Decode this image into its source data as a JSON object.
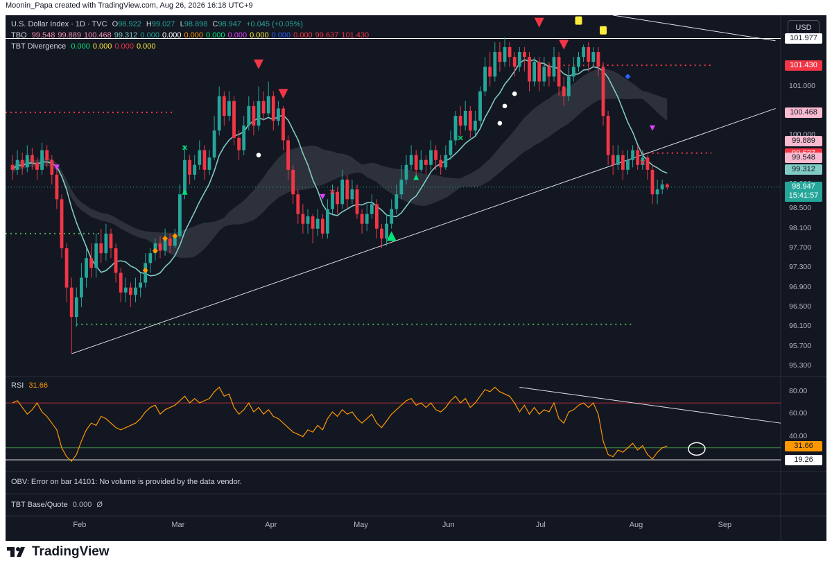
{
  "header": {
    "text": "Moonin_Papa created with TradingView.com, Aug 26, 2026 16:18 UTC+9"
  },
  "legend": {
    "symbol": "U.S. Dollar Index · 1D · TVC",
    "o_label": "O",
    "o_value": "98.922",
    "h_label": "H",
    "h_value": "99.027",
    "l_label": "L",
    "l_value": "98.898",
    "c_label": "C",
    "c_value": "98.947",
    "change": "+0.045 (+0.05%)",
    "tbo_label": "TBO",
    "tbo_values": [
      {
        "v": "99.548",
        "color": "#f48fb1"
      },
      {
        "v": "99.889",
        "color": "#f48fb1"
      },
      {
        "v": "100.468",
        "color": "#f48fb1"
      },
      {
        "v": "99.312",
        "color": "#80cbc4"
      },
      {
        "v": "0.000",
        "color": "#26a69a"
      },
      {
        "v": "0.000",
        "color": "#ffffff"
      },
      {
        "v": "0.000",
        "color": "#ff9800"
      },
      {
        "v": "0.000",
        "color": "#00e676"
      },
      {
        "v": "0.000",
        "color": "#e040fb"
      },
      {
        "v": "0.000",
        "color": "#ffeb3b"
      },
      {
        "v": "0.000",
        "color": "#2962ff"
      },
      {
        "v": "0.000",
        "color": "#f23645"
      },
      {
        "v": "99.637",
        "color": "#f23645"
      },
      {
        "v": "101.430",
        "color": "#f23645"
      }
    ],
    "div_label": "TBT Divergence",
    "div_values": [
      {
        "v": "0.000",
        "color": "#00e676"
      },
      {
        "v": "0.000",
        "color": "#ffeb3b"
      },
      {
        "v": "0.000",
        "color": "#f23645"
      },
      {
        "v": "0.000",
        "color": "#ffeb3b"
      }
    ]
  },
  "currency_button": "USD",
  "price_axis": [
    "101.000",
    "100.500",
    "100.000",
    "99.500",
    "99.000",
    "98.500",
    "98.100",
    "97.700",
    "97.300",
    "96.900",
    "96.500",
    "96.100",
    "95.700",
    "95.300"
  ],
  "price_labels": [
    {
      "text": "101.977",
      "bg": "#ffffff",
      "fg": "#131722",
      "price": 101.977
    },
    {
      "text": "101.430",
      "bg": "#f23645",
      "fg": "#ffffff",
      "price": 101.43
    },
    {
      "text": "100.468",
      "bg": "#f8bbd0",
      "fg": "#131722",
      "price": 100.468
    },
    {
      "text": "99.889",
      "bg": "#f8bbd0",
      "fg": "#131722",
      "price": 99.889
    },
    {
      "text": "99.637",
      "bg": "#f23645",
      "fg": "#ffffff",
      "price": 99.637
    },
    {
      "text": "99.548",
      "bg": "#f8bbd0",
      "fg": "#131722",
      "price": 99.548
    },
    {
      "text": "99.312",
      "bg": "#80cbc4",
      "fg": "#131722",
      "price": 99.312
    }
  ],
  "last_price": {
    "text": "98.947",
    "countdown": "15:41:57",
    "bg": "#26a69a",
    "price": 98.947
  },
  "rsi": {
    "label": "RSI",
    "value": "31.66",
    "axis": [
      "80.00",
      "60.00",
      "40.00"
    ],
    "labels": [
      {
        "text": "31.66",
        "bg": "#ff9800",
        "fg": "#131722",
        "value": 31.66
      },
      {
        "text": "19.26",
        "bg": "#ffffff",
        "fg": "#131722",
        "value": 19.26
      }
    ]
  },
  "obv_text": "OBV: Error on bar 14101: No volume is provided by the data vendor.",
  "tbt_base": {
    "label": "TBT Base/Quote",
    "value": "0.000",
    "symbol": "Ø"
  },
  "time_axis": [
    "Feb",
    "Mar",
    "Apr",
    "May",
    "Jun",
    "Jul",
    "Aug",
    "Sep"
  ],
  "brand": "TradingView",
  "colors": {
    "up": "#26a69a",
    "down": "#f23645",
    "bg": "#131722",
    "rsi": "#ff9800"
  },
  "chart_data": {
    "type": "candlestick",
    "symbol": "U.S. Dollar Index",
    "interval": "1D",
    "x_range": [
      "Jan",
      "Aug 26"
    ],
    "y_range": [
      95.1,
      102.45
    ],
    "candles": [
      [
        99.4,
        99.3,
        99.6,
        99.1
      ],
      [
        99.3,
        99.5,
        99.7,
        99.2
      ],
      [
        99.5,
        99.35,
        99.65,
        99.2
      ],
      [
        99.35,
        99.6,
        99.8,
        99.25
      ],
      [
        99.6,
        99.45,
        99.75,
        99.3
      ],
      [
        99.45,
        99.3,
        99.55,
        99.1
      ],
      [
        99.3,
        99.7,
        99.85,
        99.2
      ],
      [
        99.7,
        99.5,
        99.8,
        99.35
      ],
      [
        99.5,
        99.2,
        99.6,
        99.0
      ],
      [
        99.2,
        98.7,
        99.3,
        98.5
      ],
      [
        98.7,
        97.7,
        98.8,
        97.5
      ],
      [
        97.7,
        96.9,
        97.8,
        96.6
      ],
      [
        96.9,
        96.3,
        97.1,
        95.55
      ],
      [
        96.3,
        96.7,
        96.9,
        96.1
      ],
      [
        96.7,
        97.1,
        97.4,
        96.5
      ],
      [
        97.1,
        97.5,
        97.7,
        96.9
      ],
      [
        97.5,
        97.3,
        97.8,
        97.1
      ],
      [
        97.3,
        97.8,
        98.0,
        97.1
      ],
      [
        97.8,
        97.6,
        98.1,
        97.4
      ],
      [
        97.6,
        98.0,
        98.2,
        97.45
      ],
      [
        98.0,
        97.7,
        98.1,
        97.5
      ],
      [
        97.7,
        97.2,
        97.8,
        97.0
      ],
      [
        97.2,
        96.8,
        97.3,
        96.6
      ],
      [
        96.8,
        96.9,
        97.1,
        96.6
      ],
      [
        96.9,
        96.75,
        97.0,
        96.5
      ],
      [
        96.75,
        96.9,
        97.1,
        96.6
      ],
      [
        96.9,
        97.0,
        97.2,
        96.7
      ],
      [
        97.0,
        97.4,
        97.6,
        96.9
      ],
      [
        97.4,
        97.6,
        97.7,
        97.2
      ],
      [
        97.6,
        97.8,
        97.9,
        97.45
      ],
      [
        97.8,
        97.65,
        97.95,
        97.5
      ],
      [
        97.65,
        97.9,
        98.1,
        97.55
      ],
      [
        97.9,
        97.75,
        98.0,
        97.6
      ],
      [
        97.75,
        97.95,
        98.1,
        97.7
      ],
      [
        97.95,
        98.8,
        99.0,
        97.9
      ],
      [
        98.8,
        99.5,
        99.8,
        98.7
      ],
      [
        99.5,
        99.2,
        99.6,
        99.0
      ],
      [
        99.2,
        99.4,
        99.6,
        99.1
      ],
      [
        99.4,
        99.7,
        99.9,
        99.3
      ],
      [
        99.7,
        99.3,
        99.8,
        99.1
      ],
      [
        99.3,
        99.55,
        99.7,
        99.2
      ],
      [
        99.55,
        100.1,
        100.4,
        99.5
      ],
      [
        100.1,
        100.8,
        101.0,
        100.0
      ],
      [
        100.8,
        100.4,
        100.9,
        100.2
      ],
      [
        100.4,
        100.7,
        100.9,
        100.3
      ],
      [
        100.7,
        99.95,
        100.8,
        99.8
      ],
      [
        99.95,
        99.7,
        100.1,
        99.5
      ],
      [
        99.7,
        100.2,
        100.4,
        99.6
      ],
      [
        100.2,
        100.6,
        100.8,
        100.1
      ],
      [
        100.6,
        100.2,
        100.7,
        100.0
      ],
      [
        100.2,
        100.7,
        101.0,
        100.1
      ],
      [
        100.7,
        100.45,
        100.9,
        100.3
      ],
      [
        100.45,
        100.8,
        101.1,
        100.4
      ],
      [
        100.8,
        100.3,
        100.9,
        100.1
      ],
      [
        100.3,
        100.55,
        100.7,
        100.2
      ],
      [
        100.55,
        99.9,
        100.6,
        99.7
      ],
      [
        99.9,
        99.3,
        100.0,
        99.1
      ],
      [
        99.3,
        98.8,
        99.4,
        98.6
      ],
      [
        98.8,
        98.4,
        98.9,
        98.2
      ],
      [
        98.4,
        98.2,
        98.6,
        98.0
      ],
      [
        98.2,
        98.35,
        98.5,
        98.0
      ],
      [
        98.35,
        98.1,
        98.4,
        97.8
      ],
      [
        98.1,
        98.3,
        98.5,
        97.95
      ],
      [
        98.3,
        98.0,
        98.4,
        97.9
      ],
      [
        98.0,
        98.5,
        98.7,
        97.9
      ],
      [
        98.5,
        98.85,
        99.0,
        98.4
      ],
      [
        98.85,
        98.6,
        98.95,
        98.4
      ],
      [
        98.6,
        99.1,
        99.3,
        98.5
      ],
      [
        99.1,
        98.7,
        99.2,
        98.5
      ],
      [
        98.7,
        98.9,
        99.1,
        98.6
      ],
      [
        98.9,
        98.4,
        99.0,
        98.3
      ],
      [
        98.4,
        98.2,
        98.5,
        98.0
      ],
      [
        98.2,
        98.4,
        98.6,
        98.05
      ],
      [
        98.4,
        98.6,
        98.8,
        98.3
      ],
      [
        98.6,
        98.1,
        98.7,
        97.9
      ],
      [
        98.1,
        97.9,
        98.2,
        97.7
      ],
      [
        97.9,
        98.2,
        98.4,
        97.75
      ],
      [
        98.2,
        98.5,
        98.7,
        98.1
      ],
      [
        98.5,
        98.8,
        99.0,
        98.4
      ],
      [
        98.8,
        99.1,
        99.4,
        98.7
      ],
      [
        99.1,
        99.4,
        99.6,
        99.0
      ],
      [
        99.4,
        99.6,
        99.8,
        99.3
      ],
      [
        99.6,
        99.3,
        99.7,
        99.2
      ],
      [
        99.3,
        99.5,
        99.7,
        99.25
      ],
      [
        99.5,
        99.4,
        99.6,
        99.2
      ],
      [
        99.4,
        99.7,
        99.9,
        99.3
      ],
      [
        99.7,
        99.5,
        99.8,
        99.3
      ],
      [
        99.5,
        99.35,
        99.6,
        99.2
      ],
      [
        99.35,
        99.6,
        99.8,
        99.3
      ],
      [
        99.6,
        99.9,
        100.1,
        99.5
      ],
      [
        99.9,
        100.4,
        100.5,
        99.8
      ],
      [
        100.4,
        100.2,
        100.6,
        100.0
      ],
      [
        100.2,
        100.5,
        100.7,
        100.1
      ],
      [
        100.5,
        100.1,
        100.6,
        99.95
      ],
      [
        100.1,
        100.3,
        100.5,
        100.0
      ],
      [
        100.3,
        100.9,
        101.0,
        100.2
      ],
      [
        100.9,
        101.4,
        101.6,
        100.8
      ],
      [
        101.4,
        101.2,
        101.7,
        101.0
      ],
      [
        101.2,
        101.7,
        101.9,
        101.1
      ],
      [
        101.7,
        101.5,
        101.9,
        101.3
      ],
      [
        101.5,
        101.8,
        102.0,
        101.4
      ],
      [
        101.8,
        101.6,
        101.9,
        101.4
      ],
      [
        101.6,
        101.4,
        101.7,
        101.2
      ],
      [
        101.4,
        101.7,
        101.8,
        101.3
      ],
      [
        101.7,
        101.6,
        101.8,
        101.3
      ],
      [
        101.6,
        101.1,
        101.7,
        100.9
      ],
      [
        101.1,
        101.5,
        101.6,
        101.0
      ],
      [
        101.5,
        101.1,
        101.6,
        100.9
      ],
      [
        101.1,
        101.4,
        101.6,
        101.0
      ],
      [
        101.4,
        101.2,
        101.5,
        101.0
      ],
      [
        101.2,
        101.6,
        101.8,
        101.1
      ],
      [
        101.6,
        101.0,
        101.7,
        100.8
      ],
      [
        101.0,
        100.8,
        101.2,
        100.6
      ],
      [
        100.8,
        101.2,
        101.4,
        100.7
      ],
      [
        101.2,
        101.4,
        101.6,
        101.1
      ],
      [
        101.4,
        101.6,
        101.7,
        101.3
      ],
      [
        101.6,
        101.8,
        101.85,
        101.5
      ],
      [
        101.8,
        101.5,
        101.9,
        101.3
      ],
      [
        101.5,
        101.7,
        101.8,
        101.4
      ],
      [
        101.7,
        101.4,
        101.8,
        101.2
      ],
      [
        101.4,
        100.4,
        101.5,
        100.2
      ],
      [
        100.4,
        99.6,
        100.5,
        99.4
      ],
      [
        99.6,
        99.4,
        99.8,
        99.2
      ],
      [
        99.4,
        99.6,
        99.8,
        99.3
      ],
      [
        99.6,
        99.3,
        99.7,
        99.1
      ],
      [
        99.3,
        99.5,
        99.7,
        99.2
      ],
      [
        99.5,
        99.7,
        99.8,
        99.35
      ],
      [
        99.7,
        99.4,
        99.8,
        99.3
      ],
      [
        99.4,
        99.55,
        99.7,
        99.3
      ],
      [
        99.55,
        99.3,
        99.6,
        99.1
      ],
      [
        99.3,
        98.8,
        99.4,
        98.6
      ],
      [
        98.8,
        98.9,
        99.1,
        98.6
      ],
      [
        98.9,
        99.0,
        99.1,
        98.8
      ],
      [
        99.0,
        98.947,
        99.027,
        98.898
      ]
    ],
    "horizontal_levels": [
      {
        "price": 101.977,
        "style": "solid",
        "color": "#ffffff"
      },
      {
        "price": 101.43,
        "style": "dotted",
        "color": "#f23645"
      },
      {
        "price": 100.47,
        "style": "dotted",
        "color": "#f23645"
      },
      {
        "price": 99.64,
        "style": "dotted",
        "color": "#f23645"
      },
      {
        "price": 98.0,
        "style": "dotted",
        "color": "#4caf50"
      },
      {
        "price": 96.15,
        "style": "dotted",
        "color": "#4caf50"
      }
    ],
    "trendlines": [
      {
        "from": [
          12,
          95.55
        ],
        "to": [
          155,
          100.55
        ]
      },
      {
        "from": [
          122,
          102.45
        ],
        "to": [
          155,
          101.93
        ]
      }
    ],
    "rsi_series": [
      70,
      72,
      66,
      60,
      64,
      70,
      62,
      58,
      52,
      46,
      30,
      22,
      18,
      24,
      36,
      46,
      52,
      50,
      58,
      56,
      52,
      48,
      46,
      48,
      50,
      52,
      56,
      62,
      66,
      68,
      60,
      64,
      66,
      68,
      72,
      76,
      70,
      74,
      70,
      72,
      74,
      80,
      84,
      76,
      78,
      66,
      60,
      64,
      70,
      62,
      66,
      60,
      64,
      58,
      56,
      52,
      48,
      44,
      42,
      40,
      46,
      44,
      50,
      46,
      56,
      62,
      58,
      64,
      60,
      62,
      56,
      52,
      56,
      60,
      52,
      48,
      54,
      60,
      64,
      68,
      72,
      74,
      68,
      70,
      66,
      70,
      64,
      62,
      66,
      72,
      76,
      70,
      74,
      66,
      70,
      76,
      82,
      80,
      84,
      80,
      78,
      76,
      70,
      62,
      68,
      60,
      66,
      60,
      64,
      62,
      70,
      56,
      52,
      62,
      64,
      68,
      70,
      66,
      70,
      60,
      36,
      24,
      22,
      28,
      26,
      30,
      34,
      28,
      32,
      24,
      20,
      26,
      30,
      31.66
    ],
    "rsi_levels": [
      70,
      30
    ],
    "rsi_range": [
      15,
      88
    ],
    "months": [
      "Feb",
      "Mar",
      "Apr",
      "May",
      "Jun",
      "Jul",
      "Aug",
      "Sep"
    ]
  }
}
